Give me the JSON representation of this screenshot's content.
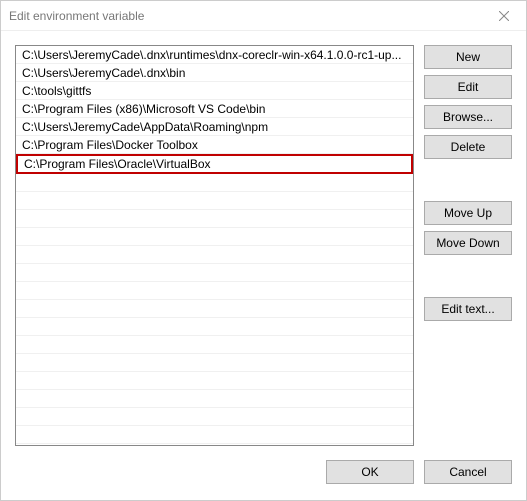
{
  "window": {
    "title": "Edit environment variable"
  },
  "list": {
    "items": [
      "C:\\Users\\JeremyCade\\.dnx\\runtimes\\dnx-coreclr-win-x64.1.0.0-rc1-up...",
      "C:\\Users\\JeremyCade\\.dnx\\bin",
      "C:\\tools\\gittfs",
      "C:\\Program Files (x86)\\Microsoft VS Code\\bin",
      "C:\\Users\\JeremyCade\\AppData\\Roaming\\npm",
      "C:\\Program Files\\Docker Toolbox",
      "C:\\Program Files\\Oracle\\VirtualBox"
    ],
    "selected_index": 6,
    "visible_rows": 22
  },
  "buttons": {
    "new": "New",
    "edit": "Edit",
    "browse": "Browse...",
    "delete": "Delete",
    "move_up": "Move Up",
    "move_down": "Move Down",
    "edit_text": "Edit text...",
    "ok": "OK",
    "cancel": "Cancel"
  }
}
